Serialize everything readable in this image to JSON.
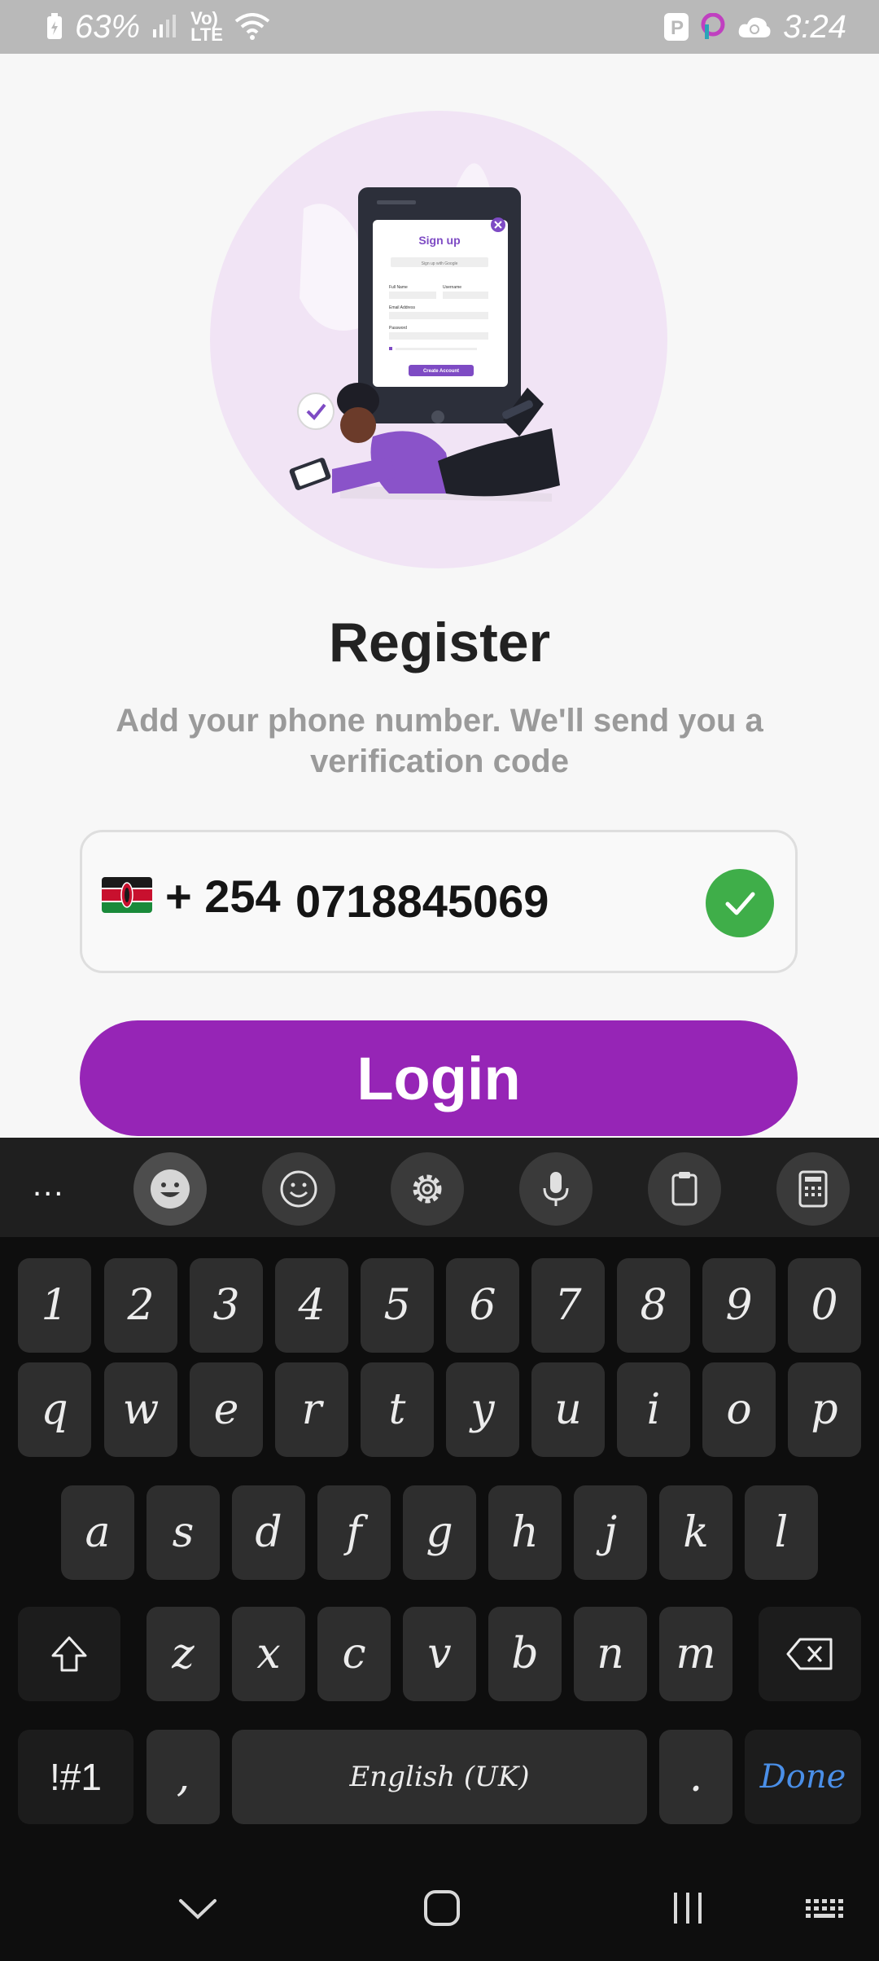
{
  "status_bar": {
    "battery": "63%",
    "time": "3:24",
    "network_top": "Vo)",
    "network_bottom": "LTE"
  },
  "illustration": {
    "card_title": "Sign up",
    "google_btn": "Sign up with Google",
    "full_name": "Full Name",
    "username": "Username",
    "email": "Email Address",
    "password": "Password",
    "create_btn": "Create Account"
  },
  "register": {
    "title": "Register",
    "subtitle": "Add your phone number. We'll send you a verification code"
  },
  "phone": {
    "country_code": "+ 254",
    "number": "0718845069",
    "valid": true
  },
  "login_button": "Login",
  "keyboard": {
    "row_numbers": [
      "1",
      "2",
      "3",
      "4",
      "5",
      "6",
      "7",
      "8",
      "9",
      "0"
    ],
    "row_1": [
      "q",
      "w",
      "e",
      "r",
      "t",
      "y",
      "u",
      "i",
      "o",
      "p"
    ],
    "row_2": [
      "a",
      "s",
      "d",
      "f",
      "g",
      "h",
      "j",
      "k",
      "l"
    ],
    "row_3": [
      "z",
      "x",
      "c",
      "v",
      "b",
      "n",
      "m"
    ],
    "symbols_key": "!#1",
    "comma_key": ",",
    "space_key": "English (UK)",
    "period_key": ".",
    "done_key": "Done",
    "more_label": "..."
  },
  "colors": {
    "accent": "#9625b6",
    "success": "#3fae49",
    "done_blue": "#4a8fe8"
  }
}
